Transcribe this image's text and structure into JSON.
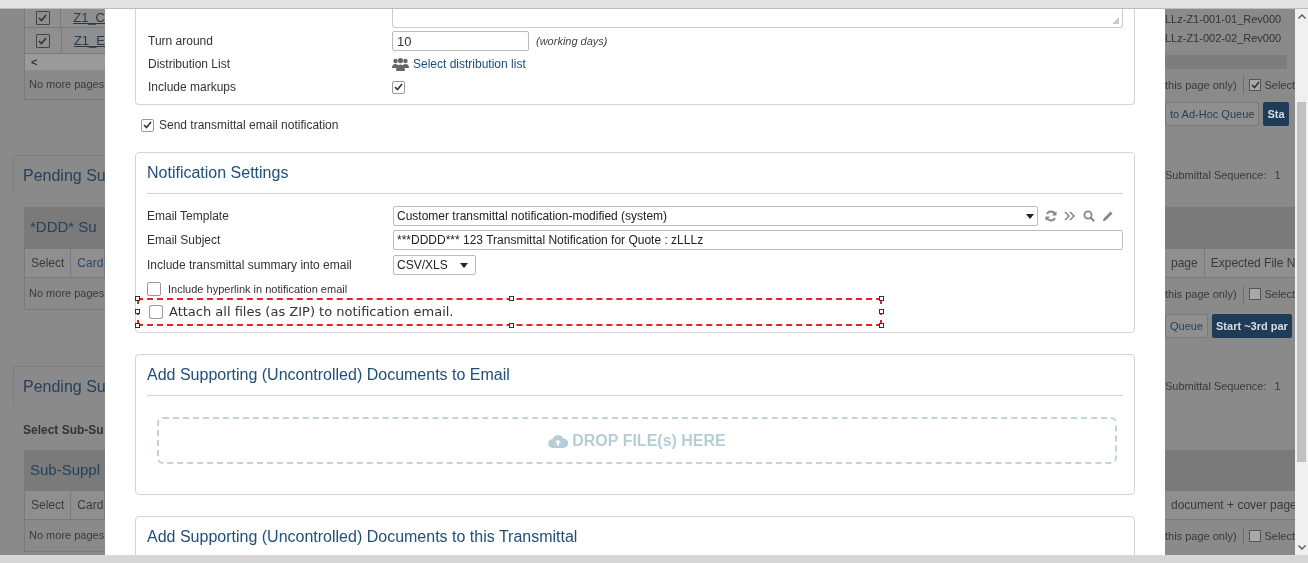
{
  "background_page": {
    "rows": [
      {
        "kind": "file-row",
        "left": {
          "checked": true,
          "name": "Z1_C"
        },
        "right": {
          "name": "LLz-Z1-001-01_Rev000"
        }
      },
      {
        "kind": "file-row",
        "left": {
          "checked": true,
          "name": "Z1_E"
        },
        "right": {
          "name": "LLz-Z1-002-02_Rev000"
        }
      },
      {
        "kind": "scrollbar",
        "left": {
          "arrow": "<"
        }
      },
      {
        "kind": "pager",
        "left": {
          "text": "No more pages"
        },
        "right": {
          "note": "this page only)",
          "checked": true,
          "label": "Select"
        }
      },
      {
        "kind": "actions",
        "right": {
          "buttons": [
            {
              "label": "to Ad-Hoc Queue",
              "primary": false
            },
            {
              "label": "Sta",
              "primary": true
            }
          ]
        }
      },
      {
        "kind": "heading",
        "left": {
          "text": "Pending Su"
        },
        "right": {
          "label": "Submittal Sequence:",
          "value": "1"
        }
      },
      {
        "kind": "table-title",
        "left": {
          "text": "*DDD* Su"
        }
      },
      {
        "kind": "header-row",
        "left": {
          "cells": [
            {
              "text": "Select",
              "link": false
            },
            {
              "text": "Card",
              "link": true
            }
          ]
        },
        "right": {
          "cells": [
            "page",
            "Expected File N"
          ]
        }
      },
      {
        "kind": "pager",
        "left": {
          "text": "No more pages"
        },
        "right": {
          "note": "this page only)",
          "checked": false,
          "label": "Select"
        }
      },
      {
        "kind": "actions",
        "right": {
          "buttons": [
            {
              "label": "Queue",
              "primary": false
            },
            {
              "label": "Start ~3rd par",
              "primary": true
            }
          ]
        }
      },
      {
        "kind": "heading",
        "left": {
          "text": "Pending Su"
        },
        "right": {
          "label": "Submittal Sequence:",
          "value": "1"
        }
      },
      {
        "kind": "sub-label",
        "left": {
          "text": "Select Sub-Su"
        }
      },
      {
        "kind": "table-title",
        "left": {
          "text": "Sub-Suppl"
        }
      },
      {
        "kind": "header-row",
        "left": {
          "cells": [
            {
              "text": "Select",
              "link": false
            },
            {
              "text": "Card",
              "link": false
            }
          ]
        },
        "right": {
          "cells": [
            "document + cover page"
          ]
        }
      },
      {
        "kind": "pager",
        "left": {
          "text": "No more pages"
        },
        "right": {
          "note": "this page only)",
          "checked": false,
          "label": "Select"
        }
      }
    ]
  },
  "dialog": {
    "turn_around": {
      "label": "Turn around",
      "value": "10",
      "hint": "(working days)"
    },
    "distribution": {
      "label": "Distribution List",
      "link": "Select distribution list"
    },
    "include_markups": {
      "label": "Include markups",
      "checked": true
    },
    "send_notification": {
      "label": "Send transmittal email notification",
      "checked": true
    },
    "notification_settings": {
      "title": "Notification Settings",
      "email_template": {
        "label": "Email Template",
        "value": "Customer transmittal notification-modified (system)"
      },
      "email_subject": {
        "label": "Email Subject",
        "value": "***DDDD*** 123 Transmittal Notification for Quote : zLLLz"
      },
      "summary": {
        "label": "Include transmittal summary into email",
        "value": "CSV/XLS"
      },
      "options": [
        {
          "label": "Include hyperlink in notification email",
          "checked": false,
          "selected": false
        },
        {
          "label": "Attach all files (as ZIP) to notification email.",
          "checked": false,
          "selected": true
        }
      ]
    },
    "email_documents": {
      "title": "Add Supporting (Uncontrolled) Documents to Email",
      "dropzone": "DROP FILE(s) HERE"
    },
    "transmittal_documents": {
      "title": "Add Supporting (Uncontrolled) Documents to this Transmittal"
    }
  }
}
